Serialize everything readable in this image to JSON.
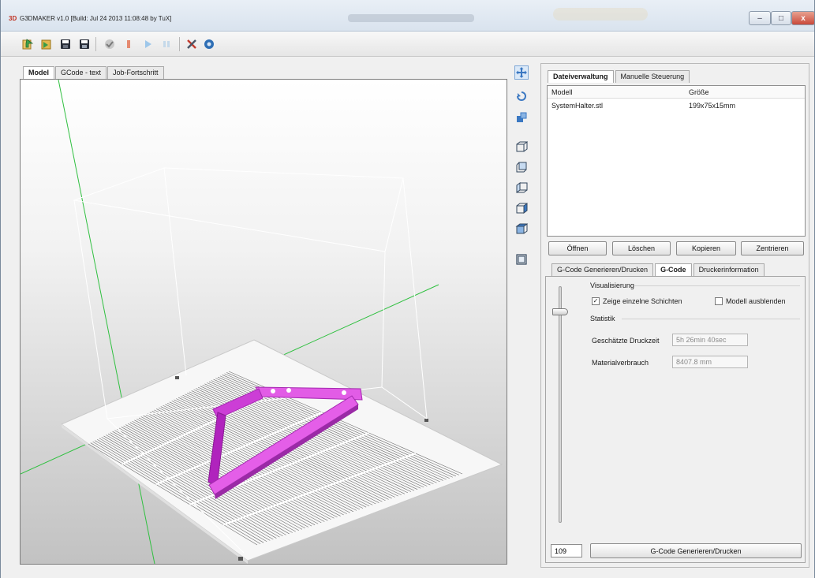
{
  "window": {
    "app_icon": "3D",
    "title": "G3DMAKER v1.0 [Build: Jul 24 2013 11:08:48 by TuX]",
    "controls": {
      "minimize": "–",
      "maximize": "□",
      "close": "x"
    }
  },
  "toolbar": {
    "icons": [
      "load-icon",
      "save-gcode-icon",
      "save-icon",
      "save-as-icon",
      "check-icon",
      "stop-icon",
      "play-icon",
      "pause-icon",
      "tools-icon",
      "settings-icon"
    ]
  },
  "view_tabs": [
    {
      "label": "Model",
      "active": true
    },
    {
      "label": "GCode - text",
      "active": false
    },
    {
      "label": "Job-Fortschritt",
      "active": false
    }
  ],
  "view_tools": {
    "icons": [
      "move-icon",
      "rotate-icon",
      "scale-icon",
      "view-front-icon",
      "view-back-icon",
      "view-left-icon",
      "view-right-icon",
      "view-top-icon",
      "view-reset-icon"
    ]
  },
  "file_panel": {
    "tabs": [
      {
        "label": "Dateiverwaltung",
        "active": true
      },
      {
        "label": "Manuelle Steuerung",
        "active": false
      }
    ],
    "columns": {
      "model": "Modell",
      "size": "Größe"
    },
    "rows": [
      {
        "model": "SystemHalter.stl",
        "size": "199x75x15mm"
      }
    ],
    "buttons": {
      "open": "Öffnen",
      "delete": "Löschen",
      "copy": "Kopieren",
      "center": "Zentrieren"
    }
  },
  "gcode_panel": {
    "tabs": [
      {
        "label": "G-Code Generieren/Drucken",
        "active": false
      },
      {
        "label": "G-Code",
        "active": true
      },
      {
        "label": "Druckerinformation",
        "active": false
      }
    ],
    "visualization_label": "Visualisierung",
    "show_layers_label": "Zeige einzelne Schichten",
    "show_layers_checked": true,
    "hide_model_label": "Modell ausblenden",
    "hide_model_checked": false,
    "statistics_label": "Statistik",
    "print_time_label": "Geschätzte Druckzeit",
    "print_time_value": "5h 26min 40sec",
    "material_label": "Materialverbrauch",
    "material_value": "8407.8 mm",
    "layer_value": "109",
    "generate_button": "G-Code Generieren/Drucken"
  }
}
